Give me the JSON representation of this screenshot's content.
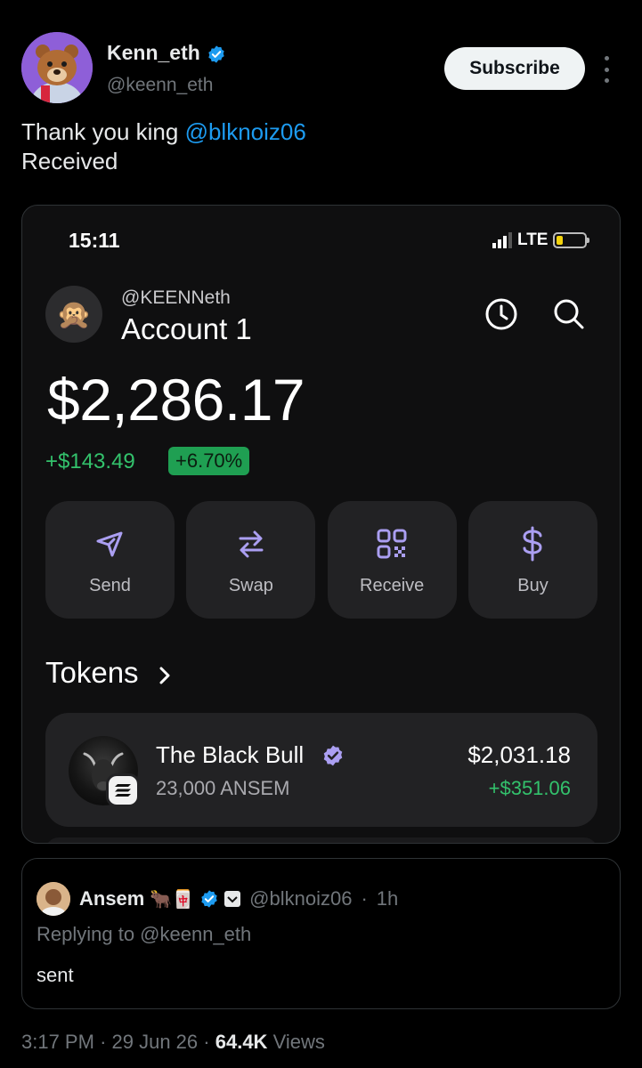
{
  "tweet": {
    "author_name": "Kenn_eth",
    "author_handle": "@keenn_eth",
    "subscribe_label": "Subscribe",
    "text_prefix": "Thank you king ",
    "mention": "@blknoiz06",
    "text_line2": "Received"
  },
  "wallet": {
    "status_time": "15:11",
    "network": "LTE",
    "handle": "@KEENNeth",
    "account_name": "Account 1",
    "avatar_emoji": "🙊",
    "balance": "$2,286.17",
    "change": "+$143.49",
    "change_pct": "+6.70%",
    "actions": [
      {
        "label": "Send",
        "icon": "send-icon"
      },
      {
        "label": "Swap",
        "icon": "swap-icon"
      },
      {
        "label": "Receive",
        "icon": "qr-code-icon"
      },
      {
        "label": "Buy",
        "icon": "dollar-icon"
      }
    ],
    "tokens_heading": "Tokens",
    "token": {
      "name": "The Black Bull",
      "amount": "23,000 ANSEM",
      "value": "$2,031.18",
      "change": "+$351.06"
    },
    "accent_color": "#ab9ff2",
    "positive_color": "#33c26c"
  },
  "reply": {
    "name": "Ansem",
    "emojis": "🐂🀄",
    "handle": "@blknoiz06",
    "time": "1h",
    "replying_to": "Replying to @keenn_eth",
    "text": "sent"
  },
  "footer": {
    "time": "3:17 PM",
    "date": "29 Jun 26",
    "views_count": "64.4K",
    "views_label": "Views"
  }
}
